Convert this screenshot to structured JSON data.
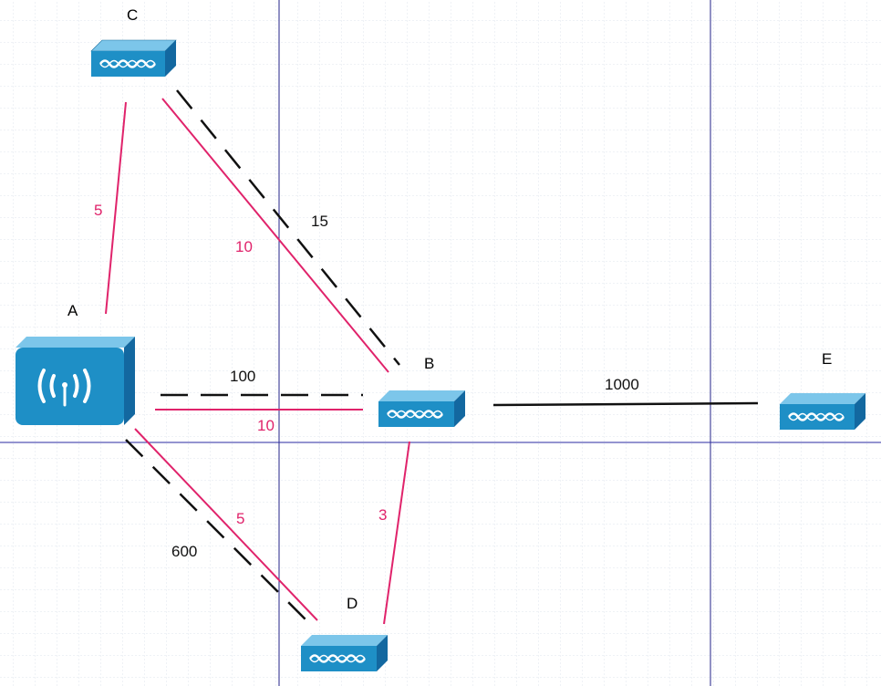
{
  "colors": {
    "pink": "#e0236b",
    "black": "#111111",
    "grid": "#c9d3db",
    "guide": "#23238a",
    "device_top": "#7cc6ea",
    "device_front": "#1e8fc6",
    "device_side": "#1368a0"
  },
  "nodes": {
    "A": {
      "label": "A",
      "type": "wireless-router"
    },
    "B": {
      "label": "B",
      "type": "switch"
    },
    "C": {
      "label": "C",
      "type": "switch"
    },
    "D": {
      "label": "D",
      "type": "switch"
    },
    "E": {
      "label": "E",
      "type": "switch"
    }
  },
  "edges": {
    "ca_pink": "5",
    "cb_pink": "10",
    "cb_dash": "15",
    "ab_dash": "100",
    "ab_pink": "10",
    "ad_pink": "5",
    "ad_dash": "600",
    "bd_pink": "3",
    "be_black": "1000"
  }
}
